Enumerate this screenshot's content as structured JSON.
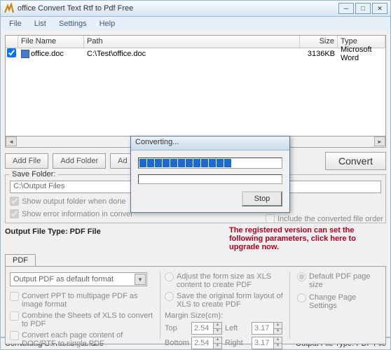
{
  "window": {
    "title": "office Convert Text Rtf to Pdf Free"
  },
  "menu": {
    "file": "File",
    "list": "List",
    "settings": "Settings",
    "help": "Help"
  },
  "cols": {
    "name": "File Name",
    "path": "Path",
    "size": "Size",
    "type": "Type"
  },
  "row": {
    "name": "office.doc",
    "path": "C:\\Test\\office.doc",
    "size": "3136KB",
    "type": "Microsoft Word"
  },
  "btns": {
    "addfile": "Add File",
    "addfolder": "Add Folder",
    "ad": "Ad",
    "convert": "Convert"
  },
  "saveFolder": {
    "legend": "Save Folder:",
    "path": "C:\\Output Files",
    "showDone": "Show output folder when done",
    "showErr": "Show error information in conver",
    "includeOrder": "Include the converted file order"
  },
  "outLabel": "Output File Type:  PDF File",
  "promo": "The registered version can set the following parameters, click here to upgrade now.",
  "tab": "PDF",
  "pdf": {
    "combo": "Output PDF as default format",
    "c1": "Convert PPT to multipage PDF as image format",
    "c2": "Combine the Sheets of XLS to convert to PDF",
    "c3": "Convert each page content of DOC/RTF to single PDF",
    "r1": "Adjust the form size as XLS content to create PDF",
    "r2": "Save the original form layout of XLS to create PDF",
    "r3": "Default PDF page size",
    "r4": "Change Page Settings",
    "margin": "Margin Size(cm):",
    "top": "Top",
    "left": "Left",
    "bottom": "Bottom",
    "right": "Right",
    "v_top": "2.54",
    "v_left": "3.17",
    "v_bottom": "2.54",
    "v_right": "3.17"
  },
  "status": {
    "left": "Converting  C:\\Test\\office.doc",
    "right": "Output File Type:  PDF File"
  },
  "modal": {
    "title": "Converting...",
    "stop": "Stop"
  }
}
